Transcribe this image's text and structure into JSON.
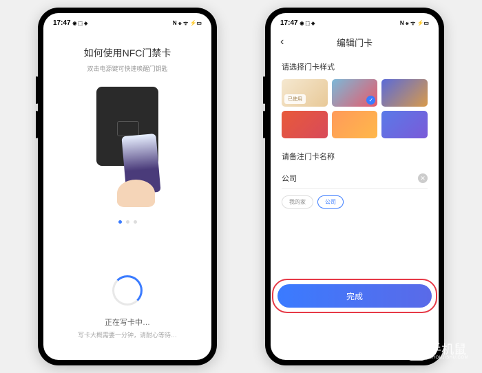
{
  "status_bar": {
    "time": "17:47",
    "left_icons": "◉ ⬚ ◈",
    "right_icons": "N ⚹ ᯤ ⚡▭"
  },
  "phone1": {
    "title": "如何使用NFC门禁卡",
    "subtitle": "双击电源键可快速唤醒门钥匙",
    "dots_active_index": 0,
    "status_title": "正在写卡中…",
    "status_subtitle": "写卡大概需要一分钟，请耐心等待…"
  },
  "phone2": {
    "header_title": "编辑门卡",
    "section_style_label": "请选择门卡样式",
    "styles": [
      {
        "used": true,
        "used_label": "已使用",
        "selected": false
      },
      {
        "used": false,
        "selected": true
      },
      {
        "used": false,
        "selected": false
      },
      {
        "used": false,
        "selected": false
      },
      {
        "used": false,
        "selected": false
      },
      {
        "used": false,
        "selected": false
      }
    ],
    "section_name_label": "请备注门卡名称",
    "name_value": "公司",
    "chips": [
      {
        "label": "我的家",
        "selected": false
      },
      {
        "label": "公司",
        "selected": true
      }
    ],
    "done_label": "完成"
  },
  "watermark": {
    "text": "手机鼠",
    "subtext": "SHOUJISHU.COM"
  }
}
